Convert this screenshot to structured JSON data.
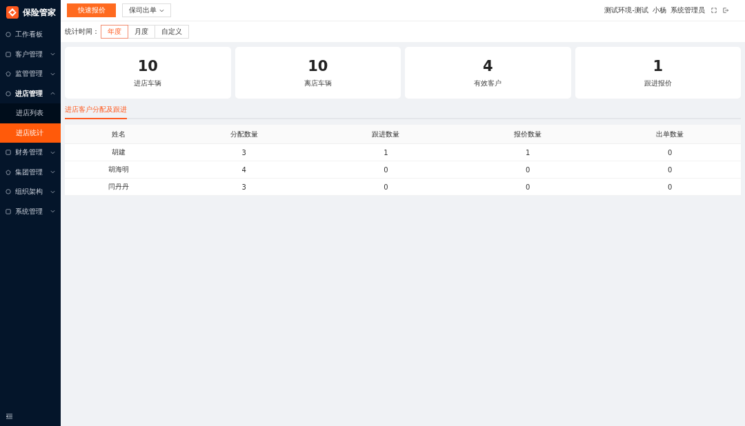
{
  "app": {
    "name": "保险管家"
  },
  "sidebar": {
    "items": [
      {
        "label": "工作看板",
        "expanded": false,
        "has_children": false
      },
      {
        "label": "客户管理",
        "expanded": false,
        "has_children": true
      },
      {
        "label": "监管管理",
        "expanded": false,
        "has_children": true
      },
      {
        "label": "进店管理",
        "expanded": true,
        "has_children": true,
        "children": [
          {
            "label": "进店列表",
            "selected": false
          },
          {
            "label": "进店统计",
            "selected": true
          }
        ]
      },
      {
        "label": "财务管理",
        "expanded": false,
        "has_children": true
      },
      {
        "label": "集团管理",
        "expanded": false,
        "has_children": true
      },
      {
        "label": "组织架构",
        "expanded": false,
        "has_children": true
      },
      {
        "label": "系统管理",
        "expanded": false,
        "has_children": true
      }
    ]
  },
  "header": {
    "buttons": [
      {
        "label": "快速报价",
        "kind": "primary"
      },
      {
        "label": "保司出单",
        "kind": "dropdown"
      }
    ],
    "environment": "测试环境-测试",
    "user": "小杨",
    "role": "系统管理员"
  },
  "filter": {
    "label": "统计时间：",
    "options": [
      {
        "label": "年度",
        "selected": true
      },
      {
        "label": "月度",
        "selected": false
      },
      {
        "label": "自定义",
        "selected": false
      }
    ]
  },
  "stats": [
    {
      "value": "10",
      "label": "进店车辆"
    },
    {
      "value": "10",
      "label": "离店车辆"
    },
    {
      "value": "4",
      "label": "有效客户"
    },
    {
      "value": "1",
      "label": "跟进报价"
    }
  ],
  "tabs": [
    {
      "label": "进店客户分配及跟进",
      "selected": true
    }
  ],
  "table": {
    "columns": [
      "姓名",
      "分配数量",
      "跟进数量",
      "报价数量",
      "出单数量"
    ],
    "rows": [
      [
        "胡建",
        "3",
        "1",
        "1",
        "0"
      ],
      [
        "胡海明",
        "4",
        "0",
        "0",
        "0"
      ],
      [
        "闫丹丹",
        "3",
        "0",
        "0",
        "0"
      ]
    ]
  }
}
